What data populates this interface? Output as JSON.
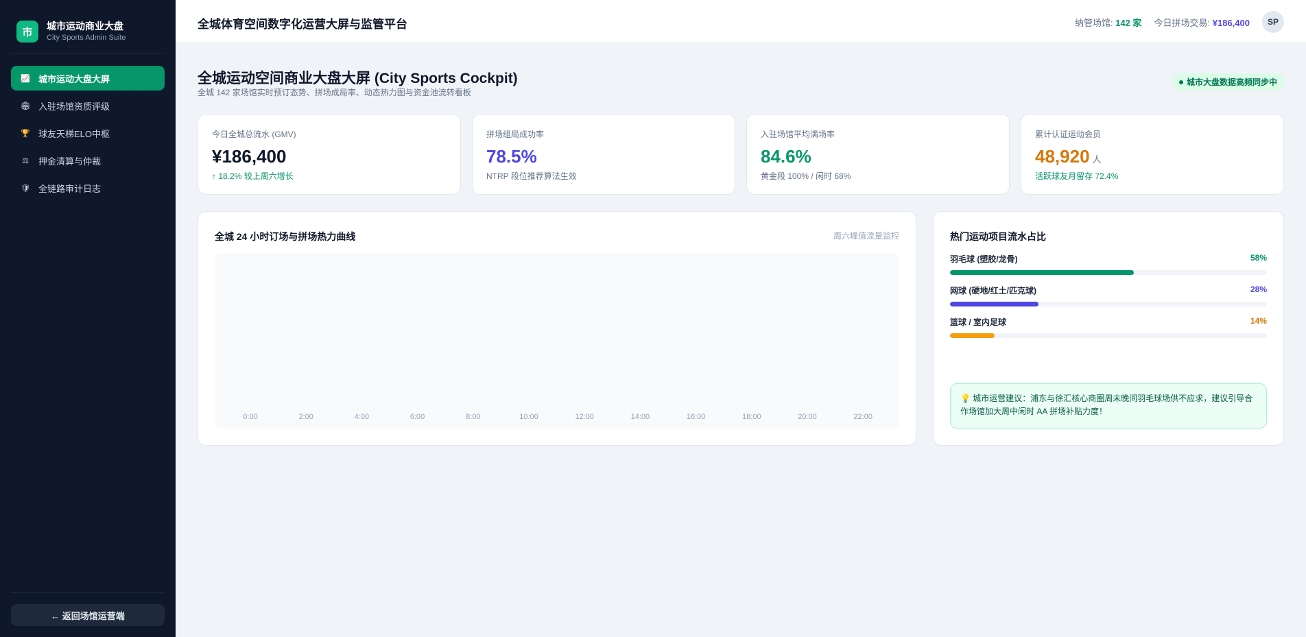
{
  "sidebar": {
    "brand": {
      "logo": "市",
      "title": "城市运动商业大盘",
      "subtitle": "City Sports Admin Suite"
    },
    "items": [
      {
        "label": "城市运动大盘大屏",
        "icon": "chart-icon",
        "glyph": "📈",
        "active": true
      },
      {
        "label": "入驻场馆资质评级",
        "icon": "venue-icon",
        "glyph": "🏟",
        "active": false
      },
      {
        "label": "球友天梯ELO中枢",
        "icon": "trophy-icon",
        "glyph": "🏆",
        "active": false
      },
      {
        "label": "押金清算与仲裁",
        "icon": "scale-icon",
        "glyph": "⚖",
        "active": false
      },
      {
        "label": "全链路审计日志",
        "icon": "shield-icon",
        "glyph": "🛡",
        "active": false
      }
    ],
    "back_label": "← 返回场馆运营端"
  },
  "header": {
    "title": "全城体育空间数字化运营大屏与监管平台",
    "venues_label": "纳管场馆:",
    "venues_value": "142 家",
    "trade_label": "今日拼场交易:",
    "trade_value": "¥186,400",
    "avatar": "SP"
  },
  "main": {
    "title": "全城运动空间商业大盘大屏 (City Sports Cockpit)",
    "subtitle": "全城 142 家场馆实时预订态势、拼场成局率、动态热力图与资金池流转看板",
    "sync_label": "城市大盘数据高频同步中"
  },
  "kpis": [
    {
      "label": "今日全城总流水 (GMV)",
      "value": "¥186,400",
      "unit": "",
      "note": "↑ 18.2% 较上周六增长",
      "value_color": "#0f172a",
      "note_color": "#059669"
    },
    {
      "label": "拼场组局成功率",
      "value": "78.5%",
      "unit": "",
      "note": "NTRP 段位推荐算法生效",
      "value_color": "#4f46e5",
      "note_color": "#64748b"
    },
    {
      "label": "入驻场馆平均满场率",
      "value": "84.6%",
      "unit": "",
      "note": "黄金段 100% / 闲时 68%",
      "value_color": "#059669",
      "note_color": "#64748b"
    },
    {
      "label": "累计认证运动会员",
      "value": "48,920",
      "unit": "人",
      "note": "活跃球友月留存 72.4%",
      "value_color": "#d97706",
      "note_color": "#059669"
    }
  ],
  "heat_panel": {
    "title": "全城 24 小时订场与拼场热力曲线",
    "meta": "周六峰值流量监控",
    "ticks": [
      "0:00",
      "2:00",
      "4:00",
      "6:00",
      "8:00",
      "10:00",
      "12:00",
      "14:00",
      "16:00",
      "18:00",
      "20:00",
      "22:00"
    ]
  },
  "share_panel": {
    "title": "热门运动项目流水占比",
    "items": [
      {
        "name": "羽毛球 (塑胶/龙骨)",
        "pct": "58%",
        "value": 58,
        "color": "#059669"
      },
      {
        "name": "网球 (硬地/红土/匹克球)",
        "pct": "28%",
        "value": 28,
        "color": "#4f46e5"
      },
      {
        "name": "篮球 / 室内足球",
        "pct": "14%",
        "value": 14,
        "color": "#f59e0b"
      }
    ],
    "advice": "💡 城市运营建议：浦东与徐汇核心商圈周末晚间羽毛球场供不应求，建议引导合作场馆加大周中闲时 AA 拼场补贴力度！"
  }
}
